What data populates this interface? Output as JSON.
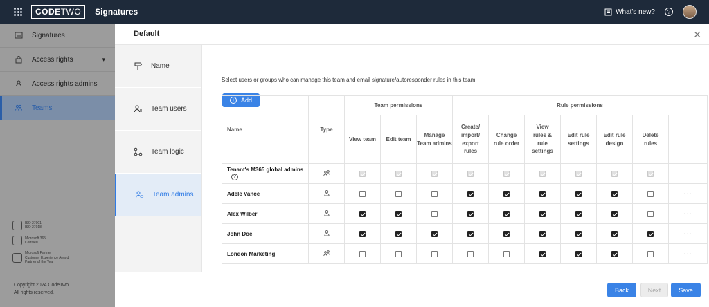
{
  "topbar": {
    "logo_code": "CODE",
    "logo_two": "TWO",
    "title": "Signatures",
    "whats_new": "What's new?",
    "help": "?"
  },
  "sidebar": {
    "items": [
      {
        "label": "Signatures",
        "icon": "signature-icon"
      },
      {
        "label": "Access rights",
        "icon": "lock-icon",
        "chevron": "▾"
      },
      {
        "label": "Access rights admins",
        "icon": "user-icon"
      },
      {
        "label": "Teams",
        "icon": "team-icon",
        "active": true
      }
    ],
    "badges": [
      {
        "lines": [
          "ISO 27001",
          "ISO 27018"
        ]
      },
      {
        "lines": [
          "Microsoft 365",
          "Certified"
        ]
      },
      {
        "lines": [
          "Microsoft Partner",
          "Customer Experience Award",
          "Partner of the Year"
        ]
      }
    ],
    "copyright": "Copyright 2024 CodeTwo.",
    "rights": "All rights reserved."
  },
  "modal": {
    "title": "Default",
    "close": "✕",
    "steps": [
      {
        "label": "Name",
        "icon": "signpost-icon"
      },
      {
        "label": "Team users",
        "icon": "team-users-icon"
      },
      {
        "label": "Team logic",
        "icon": "logic-icon"
      },
      {
        "label": "Team admins",
        "icon": "team-admin-icon",
        "active": true
      }
    ],
    "instruction": "Select users or groups who can manage this team and email signature/autoresponder rules in this team.",
    "add_label": "Add",
    "table": {
      "col_name": "Name",
      "col_type": "Type",
      "group_team": "Team permissions",
      "group_rule": "Rule permissions",
      "team_cols": [
        "View team",
        "Edit team",
        "Manage Team admins"
      ],
      "rule_cols": [
        "Create/ import/ export rules",
        "Change rule order",
        "View rules & rule settings",
        "Edit rule settings",
        "Edit rule design",
        "Delete rules"
      ],
      "rows": [
        {
          "name": "Tenant's M365 global admins",
          "info": "?",
          "type": "group",
          "perms": [
            "d",
            "d",
            "d",
            "d",
            "d",
            "d",
            "d",
            "d",
            "d"
          ],
          "menu": ""
        },
        {
          "name": "Adele Vance",
          "type": "user",
          "perms": [
            "0",
            "0",
            "0",
            "1",
            "1",
            "1",
            "1",
            "1",
            "0"
          ],
          "menu": "···"
        },
        {
          "name": "Alex Wilber",
          "type": "user",
          "perms": [
            "1",
            "1",
            "0",
            "1",
            "1",
            "1",
            "1",
            "1",
            "0"
          ],
          "menu": "···"
        },
        {
          "name": "John Doe",
          "type": "user",
          "perms": [
            "1",
            "1",
            "1",
            "1",
            "1",
            "1",
            "1",
            "1",
            "1"
          ],
          "menu": "···"
        },
        {
          "name": "London Marketing",
          "type": "group",
          "perms": [
            "0",
            "0",
            "0",
            "0",
            "0",
            "1",
            "1",
            "1",
            "0"
          ],
          "menu": "···"
        }
      ]
    },
    "buttons": {
      "back": "Back",
      "next": "Next",
      "save": "Save"
    }
  },
  "colors": {
    "accent": "#3a83e6",
    "topbar": "#1e2a3a"
  }
}
